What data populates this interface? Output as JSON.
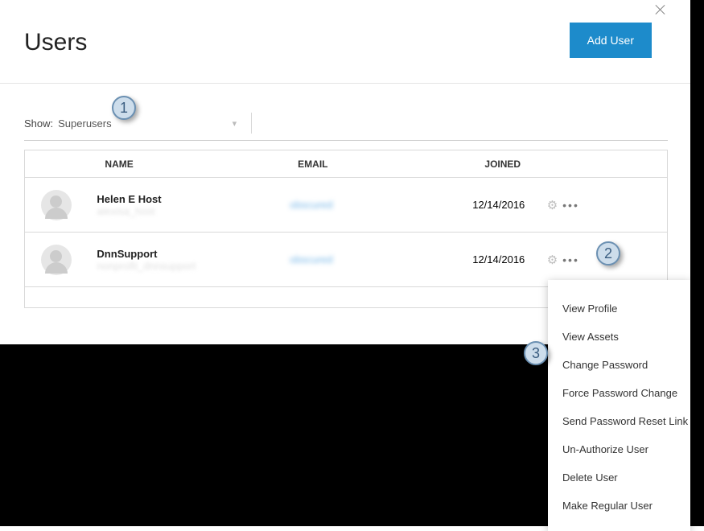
{
  "header": {
    "title": "Users",
    "add_button": "Add User"
  },
  "filter": {
    "label": "Show:",
    "value": "Superusers"
  },
  "table": {
    "columns": {
      "name": "NAME",
      "email": "EMAIL",
      "joined": "JOINED"
    },
    "rows": [
      {
        "name": "Helen E Host",
        "username": "alexisa_host",
        "email": "obscured",
        "joined": "12/14/2016"
      },
      {
        "name": "DnnSupport",
        "username": "nonprofit_dnnsupport",
        "email": "obscured",
        "joined": "12/14/2016"
      }
    ]
  },
  "context_menu": {
    "items": [
      "View Profile",
      "View Assets",
      "Change Password",
      "Force Password Change",
      "Send Password Reset Link",
      "Un-Authorize User",
      "Delete User",
      "Make Regular User"
    ]
  },
  "callouts": {
    "one": "1",
    "two": "2",
    "three": "3"
  }
}
